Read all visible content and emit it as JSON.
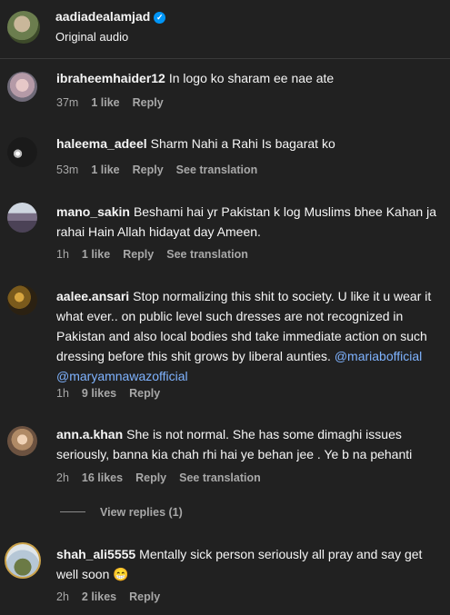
{
  "header": {
    "username": "aadiadealamjad",
    "verified_icon": "verified-badge-icon",
    "subtitle": "Original audio"
  },
  "comments": [
    {
      "username": "ibraheemhaider12",
      "text": "In logo ko sharam ee nae ate",
      "time": "37m",
      "likes": "1 like",
      "reply": "Reply",
      "translation": ""
    },
    {
      "username": "haleema_adeel",
      "text": "Sharm Nahi a Rahi Is bagarat ko",
      "time": "53m",
      "likes": "1 like",
      "reply": "Reply",
      "translation": "See translation"
    },
    {
      "username": "mano_sakin",
      "text": "Beshami hai yr Pakistan k log Muslims bhee Kahan ja rahai Hain Allah hidayat day Ameen.",
      "time": "1h",
      "likes": "1 like",
      "reply": "Reply",
      "translation": "See translation"
    },
    {
      "username": "aalee.ansari",
      "text": "Stop normalizing this shit to society. U like it u wear it what ever.. on public level such dresses are not recognized in Pakistan and also local bodies shd take immediate action on such dressing before this shit grows by liberal aunties.",
      "mention1": "@mariabofficial",
      "mention2": "@maryamnawazofficial",
      "time": "1h",
      "likes": "9 likes",
      "reply": "Reply",
      "translation": ""
    },
    {
      "username": "ann.a.khan",
      "text": "She is not normal. She has some dimaghi issues seriously, banna kia chah rhi hai ye behan jee . Ye b na pehanti",
      "time": "2h",
      "likes": "16 likes",
      "reply": "Reply",
      "translation": "See translation"
    },
    {
      "username": "shah_ali5555",
      "text": "Mentally sick person seriously all pray and say get well soon",
      "emoji": "😁",
      "time": "2h",
      "likes": "2 likes",
      "reply": "Reply",
      "translation": ""
    }
  ],
  "view_replies": "View replies (1)"
}
